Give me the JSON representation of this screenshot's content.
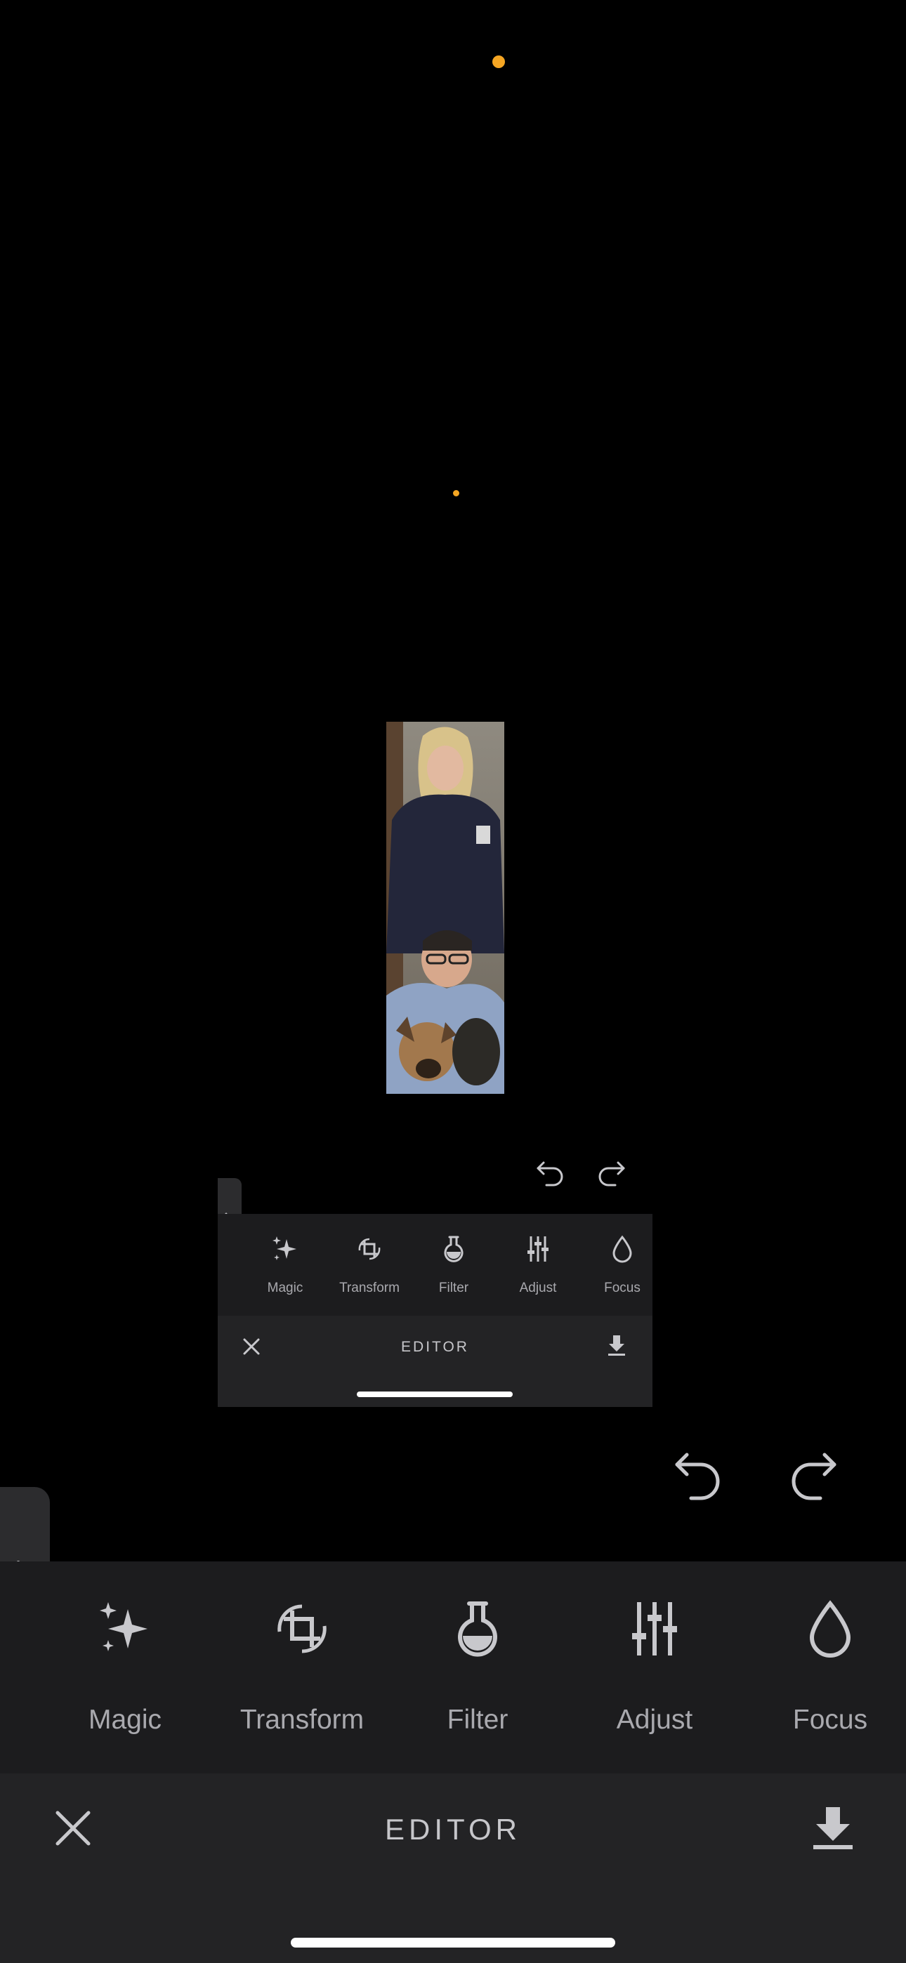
{
  "colors": {
    "accent_dot": "#f5a623",
    "toolbar_bg": "#1c1c1e",
    "editorbar_bg": "#232325",
    "icon_color": "#c8c8cc"
  },
  "mini_preview": {
    "tools": [
      {
        "label": "Magic",
        "icon": "sparkles-icon"
      },
      {
        "label": "Transform",
        "icon": "crop-rotate-icon"
      },
      {
        "label": "Filter",
        "icon": "flask-icon"
      },
      {
        "label": "Adjust",
        "icon": "sliders-icon"
      },
      {
        "label": "Focus",
        "icon": "droplet-icon"
      }
    ],
    "editor_title": "EDITOR"
  },
  "toolbar": {
    "tools": [
      {
        "label": "Magic",
        "icon": "sparkles-icon"
      },
      {
        "label": "Transform",
        "icon": "crop-rotate-icon"
      },
      {
        "label": "Filter",
        "icon": "flask-icon"
      },
      {
        "label": "Adjust",
        "icon": "sliders-icon"
      },
      {
        "label": "Focus",
        "icon": "droplet-icon"
      }
    ]
  },
  "editor_bar": {
    "title": "EDITOR"
  }
}
